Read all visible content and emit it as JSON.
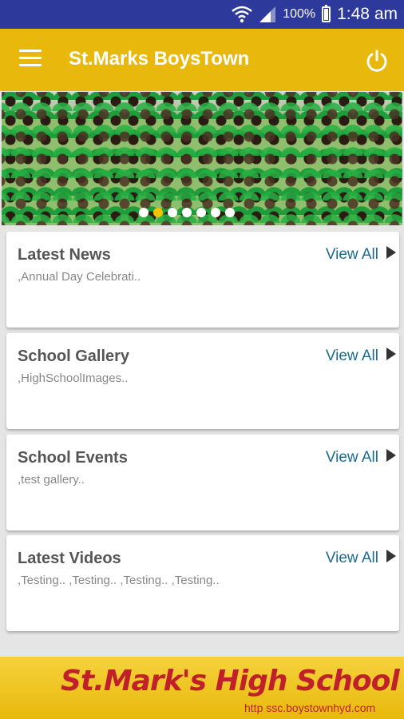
{
  "status_bar": {
    "battery_percent": "100%",
    "time": "1:48 am",
    "icons": [
      "wifi-icon",
      "signal-icon",
      "battery-icon"
    ]
  },
  "app_bar": {
    "title": "St.Marks BoysTown",
    "menu_icon": "hamburger-menu-icon",
    "power_icon": "power-icon",
    "background_color": "#e8b90c"
  },
  "banner": {
    "slide_count": 7,
    "active_slide": 1,
    "active_dot_color": "#f2c200"
  },
  "cards": [
    {
      "title": "Latest News",
      "subtitle": ",Annual Day Celebrati..",
      "action": "View All"
    },
    {
      "title": "School Gallery",
      "subtitle": ",HighSchoolImages..",
      "action": "View All"
    },
    {
      "title": "School Events",
      "subtitle": ",test gallery..",
      "action": "View All"
    },
    {
      "title": "Latest Videos",
      "subtitle": ",Testing.. ,Testing.. ,Testing.. ,Testing..",
      "action": "View All"
    }
  ],
  "footer": {
    "school_name": "St.Mark's High School",
    "url": "http  ssc.boystownhyd.com"
  },
  "colors": {
    "status_bar": "#2d3a9c",
    "link": "#1a6b8f",
    "footer_text": "#c0202a"
  }
}
